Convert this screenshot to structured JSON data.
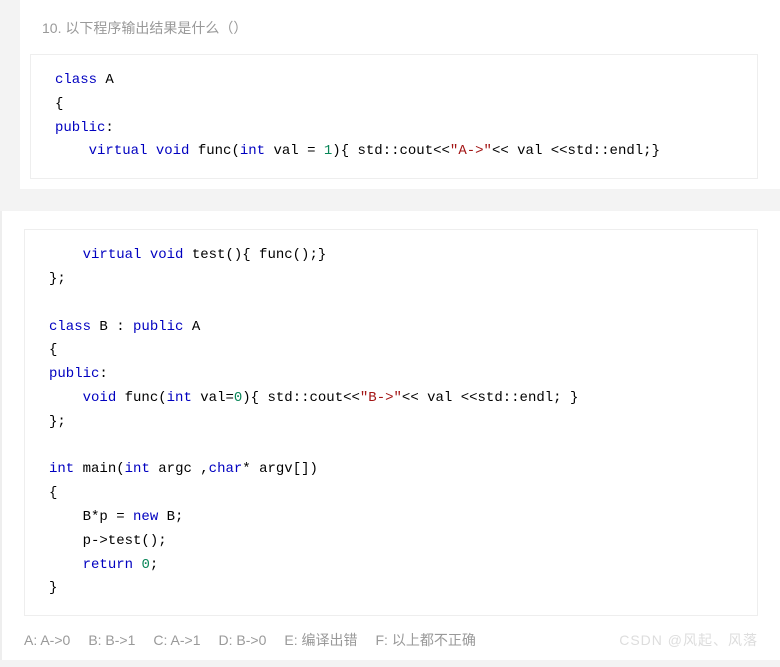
{
  "question": {
    "number": "10.",
    "text": "以下程序输出结果是什么（）"
  },
  "code_block1": {
    "line1_kw": "class",
    "line1_rest": " A",
    "line2": "{",
    "line3_kw": "public",
    "line3_rest": ":",
    "line4_indent": "    ",
    "line4_kw1": "virtual",
    "line4_sp1": " ",
    "line4_kw2": "void",
    "line4_mid": " func(",
    "line4_kw3": "int",
    "line4_mid2": " val = ",
    "line4_num": "1",
    "line4_mid3": "){ std::cout<<",
    "line4_str": "\"A->\"",
    "line4_end": "<< val <<std::endl;}"
  },
  "code_block2": {
    "l1_indent": "    ",
    "l1_kw1": "virtual",
    "l1_sp": " ",
    "l1_kw2": "void",
    "l1_rest": " test(){ func();}",
    "l2": "};",
    "l3": "",
    "l4_kw": "class",
    "l4_mid": " B : ",
    "l4_kw2": "public",
    "l4_rest": " A",
    "l5": "{",
    "l6_kw": "public",
    "l6_rest": ":",
    "l7_indent": "    ",
    "l7_kw1": "void",
    "l7_mid1": " func(",
    "l7_kw2": "int",
    "l7_mid2": " val=",
    "l7_num": "0",
    "l7_mid3": "){ std::cout<<",
    "l7_str": "\"B->\"",
    "l7_end": "<< val <<std::endl; }",
    "l8": "};",
    "l9": "",
    "l10_kw1": "int",
    "l10_mid1": " main(",
    "l10_kw2": "int",
    "l10_mid2": " argc ,",
    "l10_kw3": "char",
    "l10_rest": "* argv[])",
    "l11": "{",
    "l12_indent": "    ",
    "l12_mid": "B*p = ",
    "l12_kw": "new",
    "l12_rest": " B;",
    "l13": "    p->test();",
    "l14_indent": "    ",
    "l14_kw": "return",
    "l14_sp": " ",
    "l14_num": "0",
    "l14_rest": ";",
    "l15": "}"
  },
  "answers": {
    "a": "A: A->0",
    "b": "B: B->1",
    "c": "C: A->1",
    "d": "D: B->0",
    "e": "E: 编译出错",
    "f": "F: 以上都不正确"
  },
  "watermark": "CSDN @风起、风落"
}
